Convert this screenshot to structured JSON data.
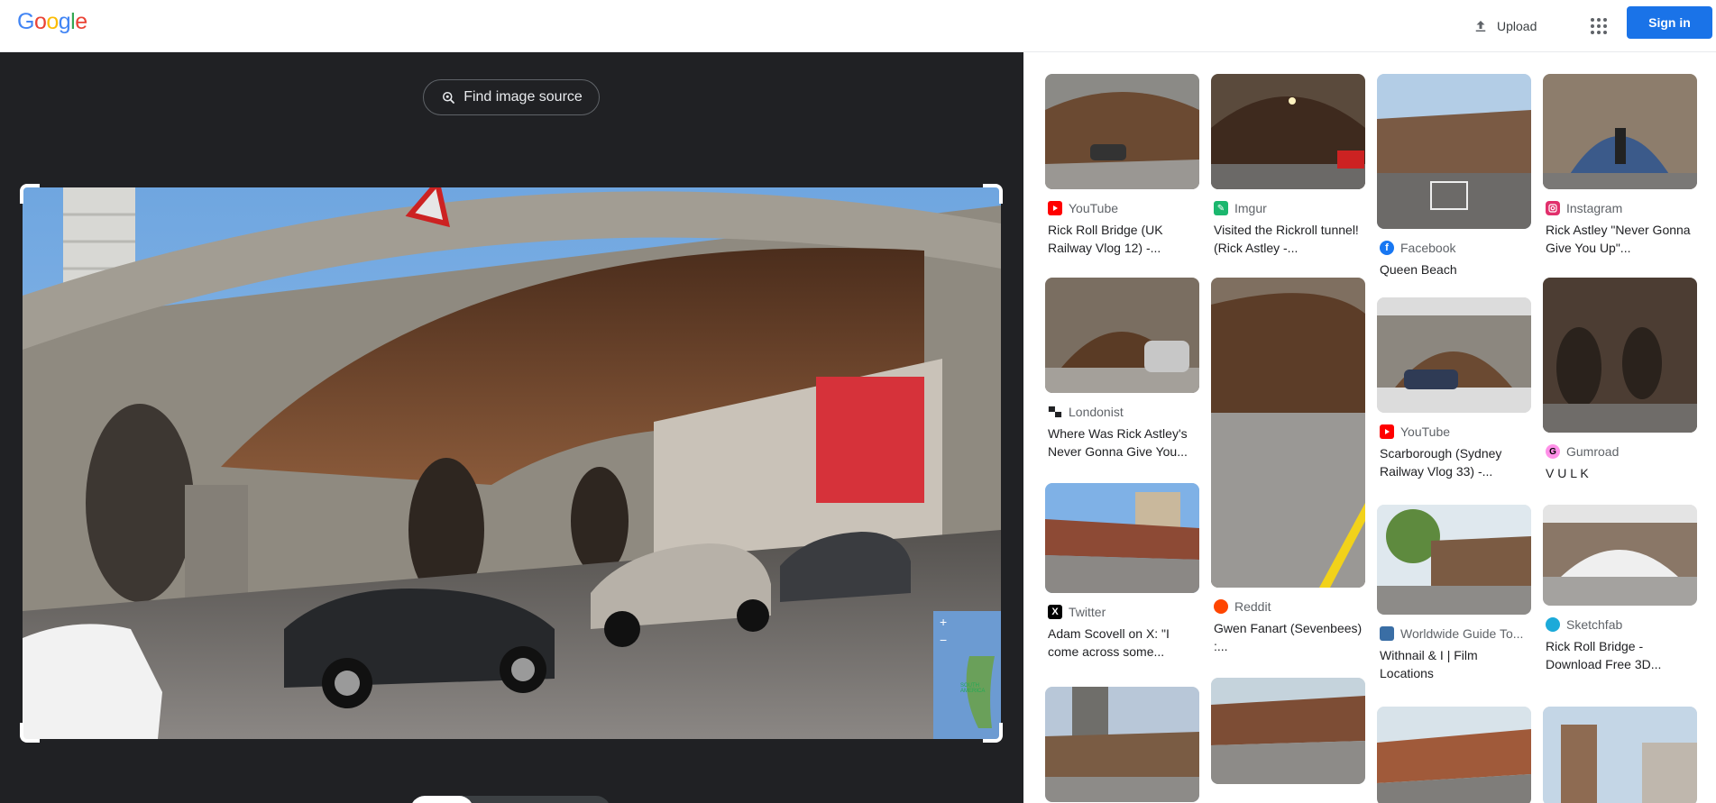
{
  "header": {
    "logo": [
      "G",
      "o",
      "o",
      "g",
      "l",
      "e"
    ],
    "logo_colors": [
      "#4285f4",
      "#ea4335",
      "#fbbc05",
      "#4285f4",
      "#34a853",
      "#ea4335"
    ],
    "upload_label": "Upload",
    "signin_label": "Sign in"
  },
  "left": {
    "find_source_label": "Find image source",
    "map_plus": "+",
    "map_minus": "−",
    "map_label": "SOUTH AMERICA"
  },
  "results": [
    {
      "source": "YouTube",
      "title": "Rick Roll Bridge (UK Railway Vlog 12) -...",
      "icon": "youtube-icon",
      "color": "#ff0000"
    },
    {
      "source": "Imgur",
      "title": "Visited the Rickroll tunnel! (Rick Astley -...",
      "icon": "imgur-icon",
      "color": "#1bb76e"
    },
    {
      "source": "Facebook",
      "title": "Queen Beach",
      "icon": "facebook-icon",
      "color": "#1877f2"
    },
    {
      "source": "Instagram",
      "title": "Rick Astley \"Never Gonna Give You Up\"...",
      "icon": "instagram-icon",
      "color": "#e1306c"
    },
    {
      "source": "Londonist",
      "title": "Where Was Rick Astley's Never Gonna Give You...",
      "icon": "londonist-icon",
      "color": "#202124"
    },
    {
      "source": "Reddit",
      "title": "Gwen Fanart (Sevenbees) :...",
      "icon": "reddit-icon",
      "color": "#ff4500"
    },
    {
      "source": "YouTube",
      "title": "Scarborough (Sydney Railway Vlog 33) -...",
      "icon": "youtube-icon",
      "color": "#ff0000"
    },
    {
      "source": "Gumroad",
      "title": "V U L K",
      "icon": "gumroad-icon",
      "color": "#ff90e8"
    },
    {
      "source": "Twitter",
      "title": "Adam Scovell on X: \"I come across some...",
      "icon": "x-icon",
      "color": "#000000"
    },
    {
      "source": "Worldwide Guide To...",
      "title": "Withnail & I | Film Locations",
      "icon": "worldwide-guide-icon",
      "color": "#3a6ea5"
    },
    {
      "source": "Sketchfab",
      "title": "Rick Roll Bridge - Download Free 3D...",
      "icon": "sketchfab-icon",
      "color": "#1caad9"
    },
    {
      "source": "",
      "title": "",
      "icon": "",
      "color": ""
    },
    {
      "source": "",
      "title": "",
      "icon": "",
      "color": ""
    },
    {
      "source": "",
      "title": "",
      "icon": "",
      "color": ""
    },
    {
      "source": "",
      "title": "",
      "icon": "",
      "color": ""
    }
  ]
}
